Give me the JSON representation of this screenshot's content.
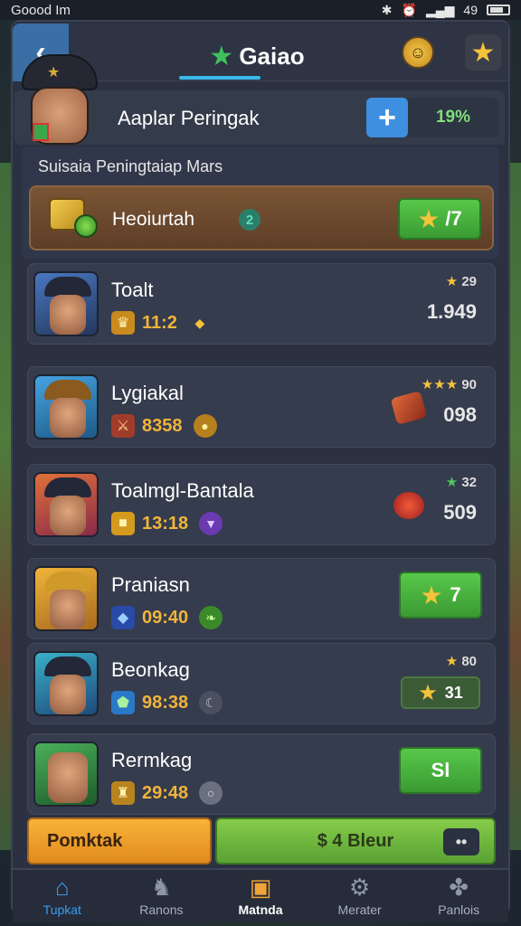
{
  "status_bar": {
    "carrier": "Goood Im",
    "battery": "49"
  },
  "header": {
    "title": "Gaiao",
    "back_icon": "chevron-left-icon"
  },
  "profile": {
    "name": "Aaplar Peringak",
    "percent_value": "19%",
    "percent_symbol": "%"
  },
  "section": {
    "title": "Suisaia Peningtaiap Mars"
  },
  "featured": {
    "name": "Heoiurtah",
    "info_glyph": "2",
    "button_value": "/7"
  },
  "rows": [
    {
      "name": "Toalt",
      "stat": "11:2",
      "rank_stars": "★",
      "rank_count": "29",
      "rank_value": "1.949",
      "avatar_bg": "#3f66a8"
    },
    {
      "name": "Lygiakal",
      "stat": "8358",
      "rank_stars": "★★★",
      "rank_count": "90",
      "rank_value": "098",
      "avatar_bg": "#3f8fd0"
    },
    {
      "name": "Toalmgl-Bantala",
      "stat": "13:18",
      "rank_stars": "★",
      "rank_count": "32",
      "rank_value": "509",
      "avatar_bg": "#c25a33"
    },
    {
      "name": "Praniasn",
      "stat": "09:40",
      "button_value": "7",
      "avatar_bg": "#d8a93a"
    },
    {
      "name": "Beonkag",
      "stat": "98:38",
      "rank_stars": "★",
      "rank_count": "80",
      "mini_value": "31",
      "avatar_bg": "#2f8fb0"
    },
    {
      "name": "Rermkag",
      "stat": "29:48",
      "button_value": "Sl",
      "avatar_bg": "#3c8a4a"
    }
  ],
  "actions": {
    "left_button": "Pomktak",
    "right_button": "$ 4 Bleur",
    "more": "••"
  },
  "tabs": [
    {
      "label": "Tupkat",
      "icon": "home-icon"
    },
    {
      "label": "Ranons",
      "icon": "ranking-icon"
    },
    {
      "label": "Matnda",
      "icon": "chest-icon"
    },
    {
      "label": "Merater",
      "icon": "gear-icon"
    },
    {
      "label": "Panlois",
      "icon": "puzzle-icon"
    }
  ],
  "colors": {
    "accent_blue": "#3a9df2",
    "green": "#3a9a33",
    "orange": "#e08a1e",
    "gold": "#f5c33b"
  }
}
